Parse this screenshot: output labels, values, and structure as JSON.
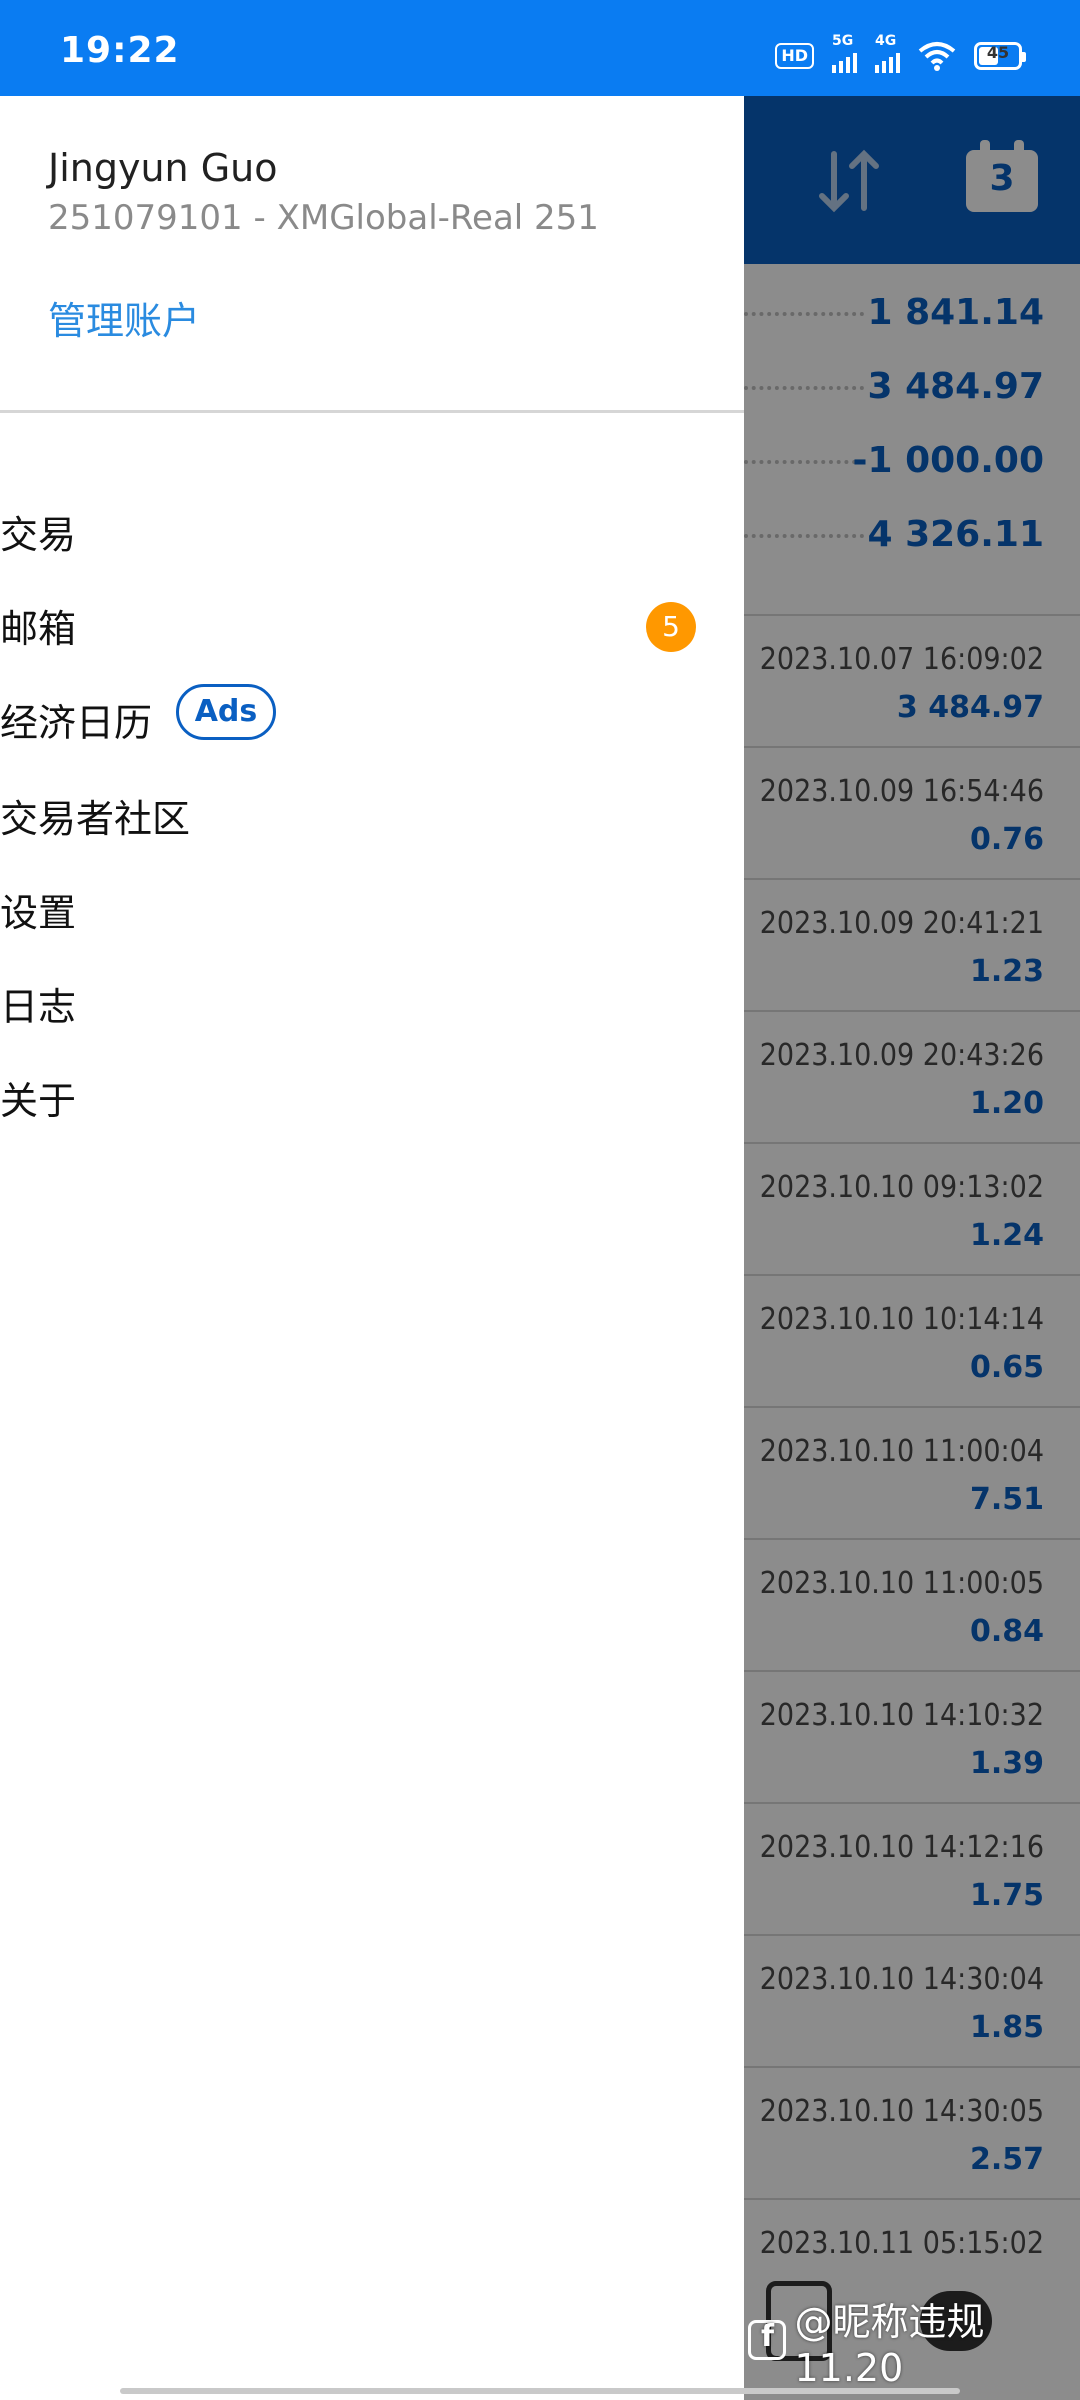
{
  "status_bar": {
    "time": "19:22",
    "hd": "HD",
    "net1": "5G",
    "net2": "4G",
    "battery": "45",
    "icons": [
      "hd-icon",
      "signal-5g-icon",
      "signal-4g-icon",
      "wifi-icon",
      "battery-icon"
    ]
  },
  "drawer": {
    "account_name": "Jingyun Guo",
    "account_id": "251079101 - XMGlobal-Real 251",
    "manage_label": "管理账户",
    "menu": [
      {
        "label": "交易"
      },
      {
        "label": "邮箱",
        "badge": "5"
      },
      {
        "label": "经济日历",
        "tag": "Ads"
      },
      {
        "label": "交易者社区"
      },
      {
        "label": "设置"
      },
      {
        "label": "日志"
      },
      {
        "label": "关于"
      }
    ]
  },
  "background_app": {
    "calendar_day": "3",
    "summary_values": [
      "1 841.14",
      "3 484.97",
      "-1 000.00",
      "4 326.11"
    ],
    "deals": [
      {
        "time": "2023.10.07 16:09:02",
        "value": "3 484.97"
      },
      {
        "time": "2023.10.09 16:54:46",
        "value": "0.76"
      },
      {
        "time": "2023.10.09 20:41:21",
        "value": "1.23"
      },
      {
        "time": "2023.10.09 20:43:26",
        "value": "1.20"
      },
      {
        "time": "2023.10.10 09:13:02",
        "value": "1.24"
      },
      {
        "time": "2023.10.10 10:14:14",
        "value": "0.65"
      },
      {
        "time": "2023.10.10 11:00:04",
        "value": "7.51"
      },
      {
        "time": "2023.10.10 11:00:05",
        "value": "0.84"
      },
      {
        "time": "2023.10.10 14:10:32",
        "value": "1.39"
      },
      {
        "time": "2023.10.10 14:12:16",
        "value": "1.75"
      },
      {
        "time": "2023.10.10 14:30:04",
        "value": "1.85"
      },
      {
        "time": "2023.10.10 14:30:05",
        "value": "2.57"
      },
      {
        "time": "2023.10.11 05:15:02",
        "value": ""
      }
    ],
    "accent_color": "#0a5fc2"
  },
  "watermark": "@昵称违规11.20"
}
